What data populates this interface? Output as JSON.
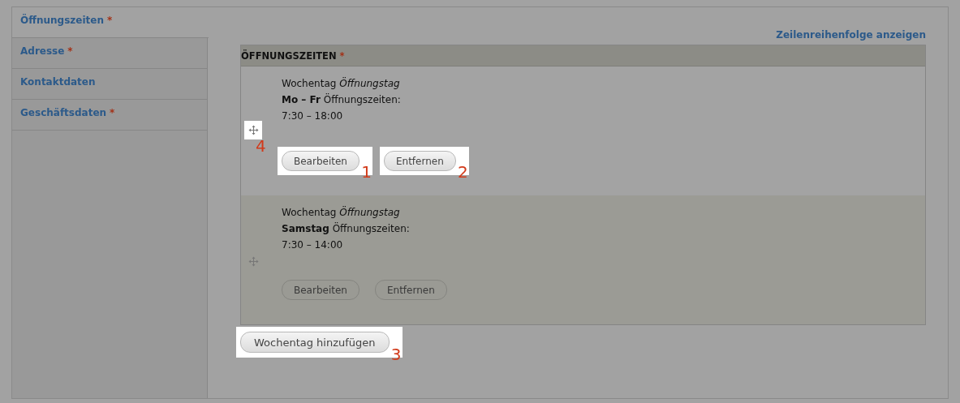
{
  "tabs": [
    {
      "label": "Öffnungszeiten",
      "required_mark": "*",
      "selected": true
    },
    {
      "label": "Adresse",
      "required_mark": "*",
      "selected": false
    },
    {
      "label": "Kontaktdaten",
      "selected": false
    },
    {
      "label": "Geschäftsdaten",
      "required_mark": "*",
      "selected": false
    }
  ],
  "row_order_link": "Zeilenreihenfolge anzeigen",
  "table": {
    "title": "ÖFFNUNGSZEITEN",
    "required_mark": "*",
    "rows": [
      {
        "lines": [
          "Wochentag *Öffnungstag*",
          "**Mo – Fr** Öffnungszeiten:",
          "7:30 – 18:00"
        ],
        "handle_marker": "4",
        "buttons": [
          {
            "label": "Bearbeiten",
            "marker": "1"
          },
          {
            "label": "Entfernen",
            "marker": "2"
          }
        ]
      },
      {
        "lines": [
          "Wochentag *Öffnungstag*",
          "**Samstag** Öffnungszeiten:",
          "7:30 – 14:00"
        ],
        "buttons": [
          {
            "label": "Bearbeiten"
          },
          {
            "label": "Entfernen"
          }
        ]
      }
    ]
  },
  "add_button": {
    "label": "Wochentag hinzufügen",
    "marker": "3"
  }
}
